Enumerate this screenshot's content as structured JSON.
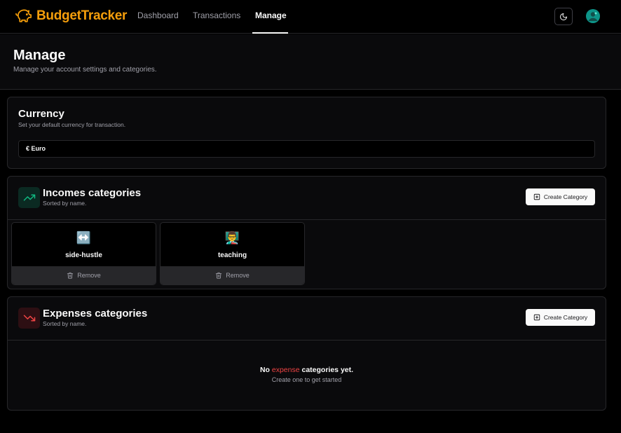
{
  "app": {
    "name": "BudgetTracker",
    "brand_color": "#f59e0b"
  },
  "nav": {
    "items": [
      {
        "label": "Dashboard",
        "active": false
      },
      {
        "label": "Transactions",
        "active": false
      },
      {
        "label": "Manage",
        "active": true
      }
    ]
  },
  "header": {
    "title": "Manage",
    "subtitle": "Manage your account settings and categories."
  },
  "currency": {
    "title": "Currency",
    "subtitle": "Set your default currency for transaction.",
    "selected": "€ Euro"
  },
  "incomes": {
    "title": "Incomes categories",
    "subtitle": "Sorted by name.",
    "create_label": "Create Category",
    "accent": "#10b981",
    "categories": [
      {
        "icon": "↔️",
        "name": "side-hustle",
        "remove_label": "Remove"
      },
      {
        "icon": "👨‍🏫",
        "name": "teaching",
        "remove_label": "Remove"
      }
    ]
  },
  "expenses": {
    "title": "Expenses categories",
    "subtitle": "Sorted by name.",
    "create_label": "Create Category",
    "accent": "#ef4444",
    "empty": {
      "prefix": "No",
      "highlight": "expense",
      "suffix": "categories yet.",
      "subtitle": "Create one to get started"
    }
  }
}
